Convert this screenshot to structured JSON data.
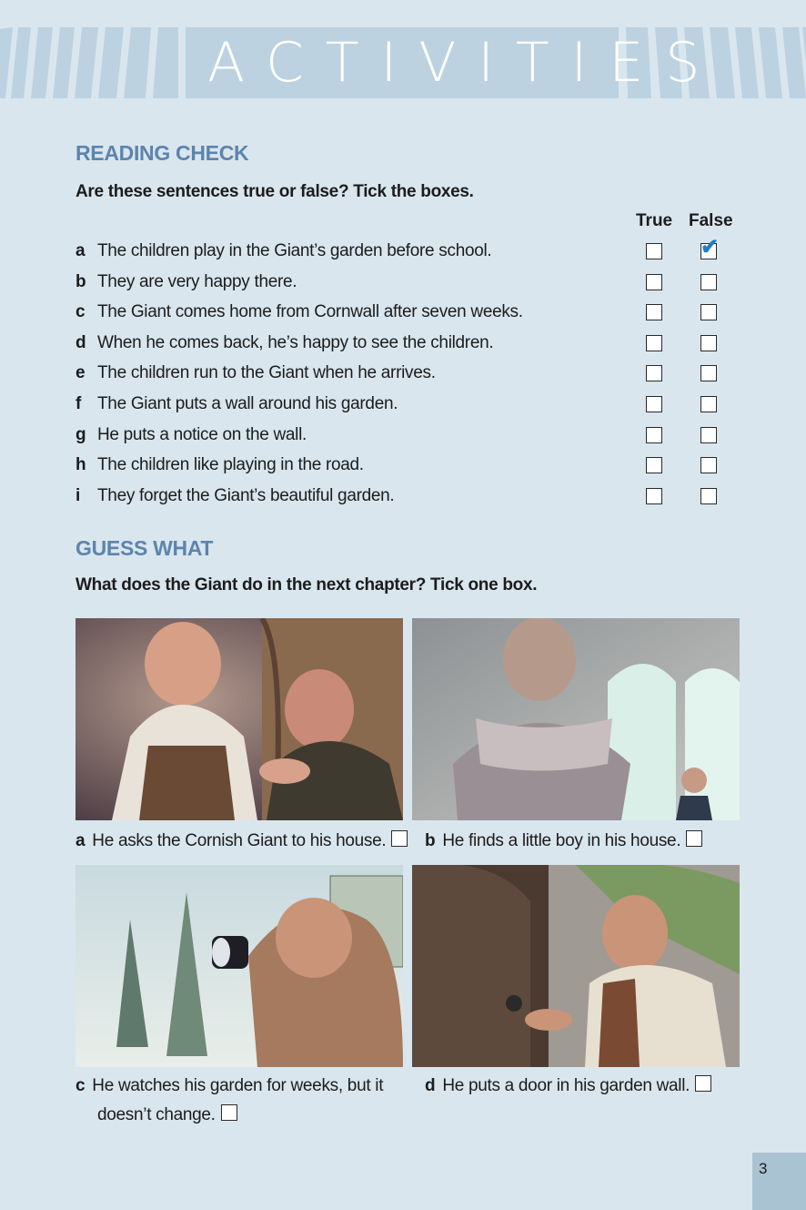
{
  "banner": {
    "title": "ACTIVITIES"
  },
  "reading_check": {
    "title": "READING CHECK",
    "instruction": "Are these sentences true or false? Tick the boxes.",
    "col_true": "True",
    "col_false": "False",
    "items": [
      {
        "letter": "a",
        "text": "The children play in the Giant’s garden before school.",
        "ticked": "false"
      },
      {
        "letter": "b",
        "text": "They are very happy there.",
        "ticked": ""
      },
      {
        "letter": "c",
        "text": "The Giant comes home from Cornwall after seven weeks.",
        "ticked": ""
      },
      {
        "letter": "d",
        "text": "When he comes back, he’s happy to see the children.",
        "ticked": ""
      },
      {
        "letter": "e",
        "text": "The children run to the Giant when he arrives.",
        "ticked": ""
      },
      {
        "letter": "f",
        "text": "The Giant puts a wall around his garden.",
        "ticked": ""
      },
      {
        "letter": "g",
        "text": "He puts a notice on the wall.",
        "ticked": ""
      },
      {
        "letter": "h",
        "text": "The children like playing in the road.",
        "ticked": ""
      },
      {
        "letter": "i",
        "text": "They forget the Giant’s beautiful garden.",
        "ticked": ""
      }
    ],
    "check_glyph": "✔"
  },
  "guess_what": {
    "title": "GUESS WHAT",
    "instruction": "What does the Giant do in the next chapter? Tick one box.",
    "options": [
      {
        "letter": "a",
        "text": "He asks the Cornish Giant to his house."
      },
      {
        "letter": "b",
        "text": "He finds a little boy in his house."
      },
      {
        "letter": "c",
        "text": "He watches his garden for weeks, but it",
        "text2": "doesn’t change."
      },
      {
        "letter": "d",
        "text": "He puts a door in his garden wall."
      }
    ]
  },
  "page_number": "3",
  "colors": {
    "accent": "#5d84ad",
    "banner": "#bcd2e0",
    "page_bg": "#d9e6ee",
    "check": "#1f7fc4"
  }
}
